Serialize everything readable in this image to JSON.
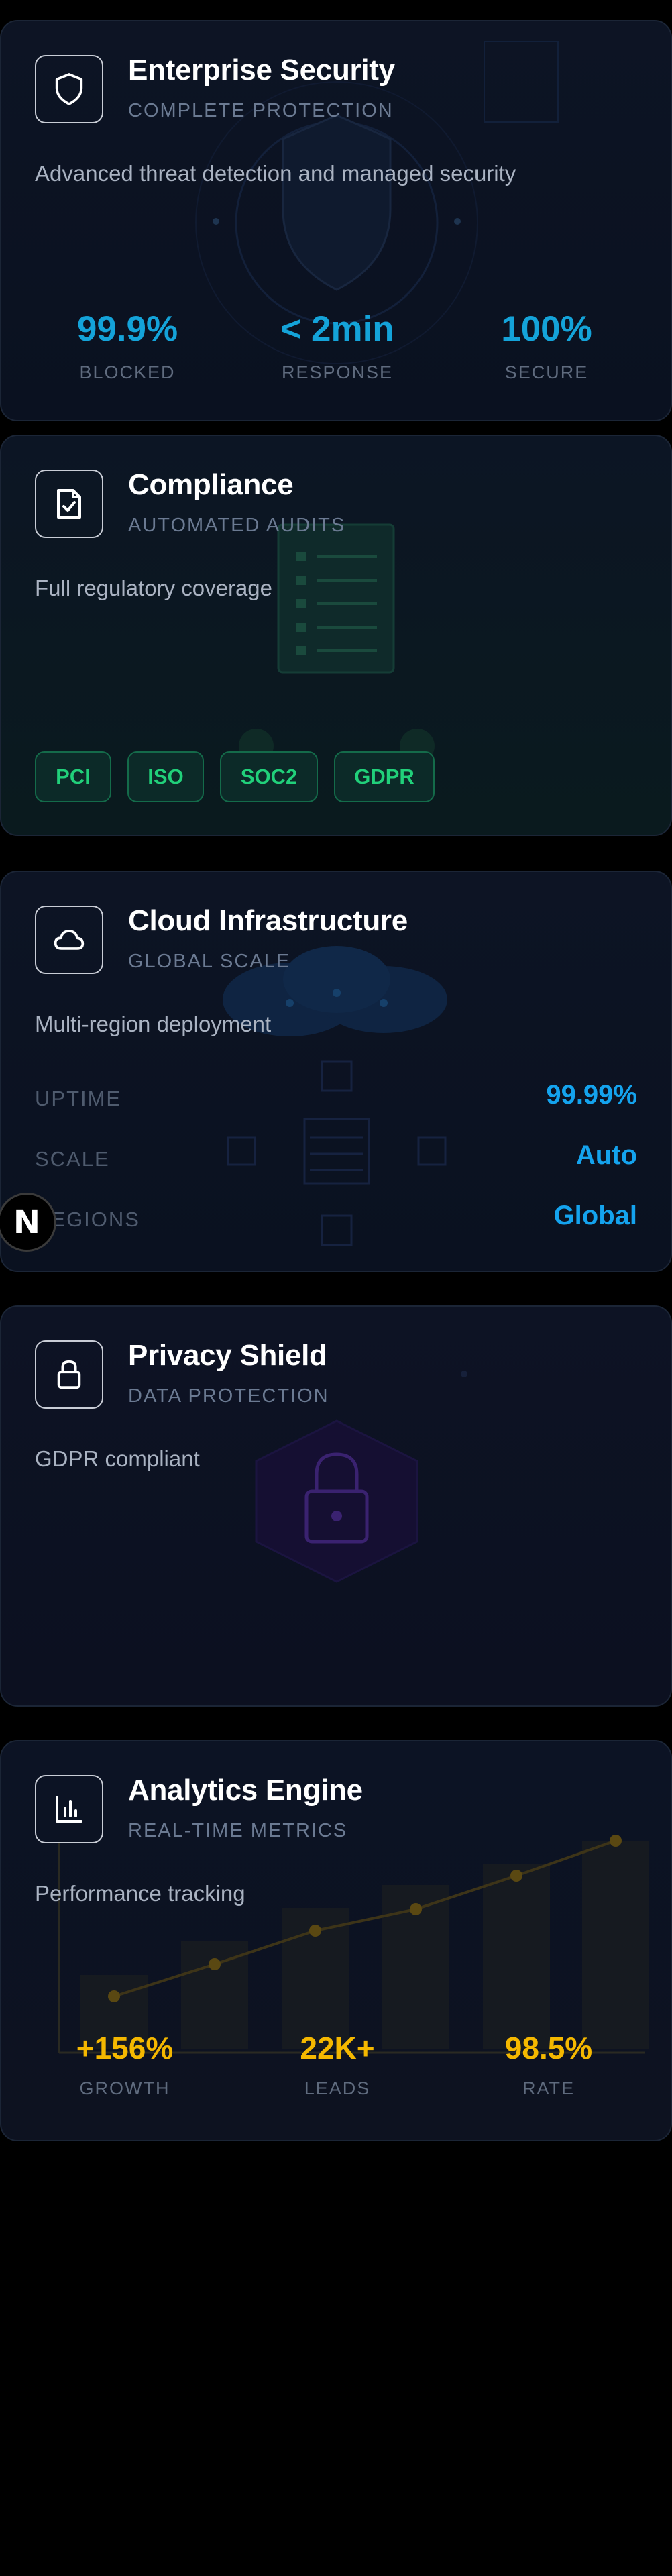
{
  "cards": [
    {
      "title": "Enterprise Security",
      "subtitle": "COMPLETE PROTECTION",
      "description": "Advanced threat detection and managed security",
      "icon": "shield-icon",
      "stats": [
        {
          "value": "99.9%",
          "label": "BLOCKED"
        },
        {
          "value": "< 2min",
          "label": "RESPONSE"
        },
        {
          "value": "100%",
          "label": "SECURE"
        }
      ],
      "accent": "#14a3d9"
    },
    {
      "title": "Compliance",
      "subtitle": "AUTOMATED AUDITS",
      "description": "Full regulatory coverage",
      "icon": "file-check-icon",
      "badges": [
        "PCI",
        "ISO",
        "SOC2",
        "GDPR"
      ],
      "accent": "#21d07a"
    },
    {
      "title": "Cloud Infrastructure",
      "subtitle": "GLOBAL SCALE",
      "description": "Multi-region deployment",
      "icon": "cloud-icon",
      "rows": [
        {
          "label": "UPTIME",
          "value": "99.99%"
        },
        {
          "label": "SCALE",
          "value": "Auto"
        },
        {
          "label": "REGIONS",
          "value": "Global"
        }
      ],
      "accent": "#14a3ee"
    },
    {
      "title": "Privacy Shield",
      "subtitle": "DATA PROTECTION",
      "description": "GDPR compliant",
      "icon": "lock-icon",
      "accent": "#7b3fd6"
    },
    {
      "title": "Analytics Engine",
      "subtitle": "REAL-TIME METRICS",
      "description": "Performance tracking",
      "icon": "bar-chart-icon",
      "stats": [
        {
          "value": "+156%",
          "label": "GROWTH"
        },
        {
          "value": "22K+",
          "label": "LEADS"
        },
        {
          "value": "98.5%",
          "label": "RATE"
        }
      ],
      "accent": "#f5b800"
    }
  ],
  "fab": {
    "label": "N"
  }
}
